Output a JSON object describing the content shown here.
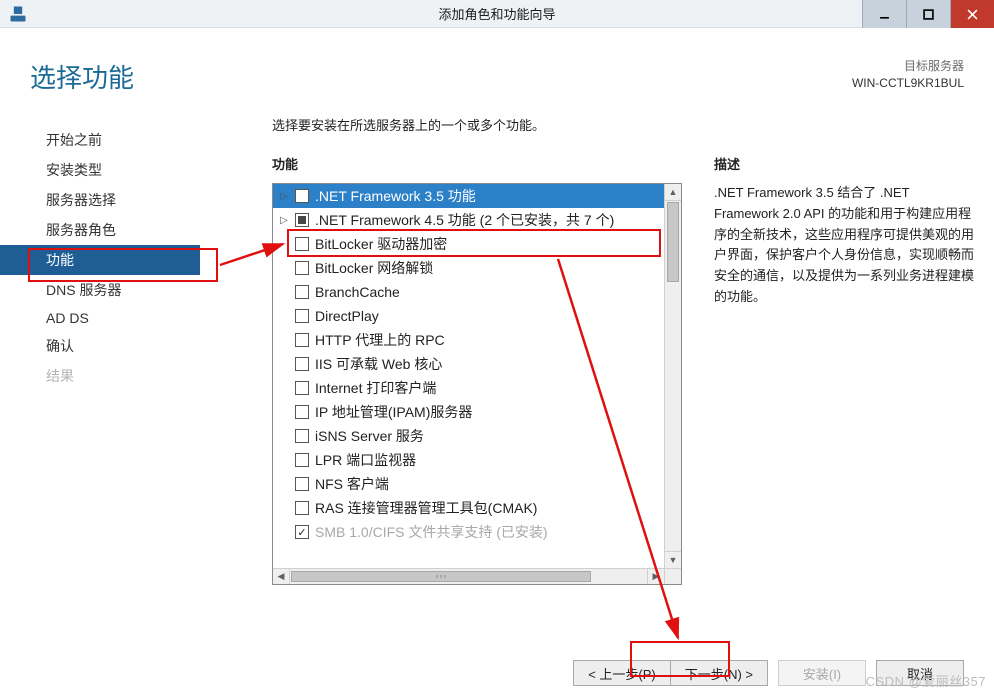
{
  "window": {
    "title": "添加角色和功能向导"
  },
  "header": {
    "title": "选择功能",
    "target_label": "目标服务器",
    "target_name": "WIN-CCTL9KR1BUL"
  },
  "steps": {
    "items": [
      {
        "label": "开始之前",
        "active": false,
        "disabled": false
      },
      {
        "label": "安装类型",
        "active": false,
        "disabled": false
      },
      {
        "label": "服务器选择",
        "active": false,
        "disabled": false
      },
      {
        "label": "服务器角色",
        "active": false,
        "disabled": false
      },
      {
        "label": "功能",
        "active": true,
        "disabled": false
      },
      {
        "label": "DNS 服务器",
        "active": false,
        "disabled": false
      },
      {
        "label": "AD DS",
        "active": false,
        "disabled": false
      },
      {
        "label": "确认",
        "active": false,
        "disabled": false
      },
      {
        "label": "结果",
        "active": false,
        "disabled": true
      }
    ]
  },
  "main": {
    "instruction": "选择要安装在所选服务器上的一个或多个功能。",
    "features_label": "功能",
    "description_label": "描述",
    "description": ".NET Framework 3.5 结合了 .NET Framework 2.0 API 的功能和用于构建应用程序的全新技术，这些应用程序可提供美观的用户界面，保护客户个人身份信息，实现顺畅而安全的通信，以及提供为一系列业务进程建模的功能。",
    "features": [
      {
        "label": ".NET Framework 3.5 功能",
        "checked": "none",
        "expand": "right",
        "selected": true,
        "disabled": false
      },
      {
        "label": ".NET Framework 4.5 功能 (2 个已安装，共 7 个)",
        "checked": "partial",
        "expand": "right",
        "selected": false,
        "disabled": false
      },
      {
        "label": "BitLocker 驱动器加密",
        "checked": "none",
        "expand": "none",
        "selected": false,
        "disabled": false
      },
      {
        "label": "BitLocker 网络解锁",
        "checked": "none",
        "expand": "none",
        "selected": false,
        "disabled": false
      },
      {
        "label": "BranchCache",
        "checked": "none",
        "expand": "none",
        "selected": false,
        "disabled": false
      },
      {
        "label": "DirectPlay",
        "checked": "none",
        "expand": "none",
        "selected": false,
        "disabled": false
      },
      {
        "label": "HTTP 代理上的 RPC",
        "checked": "none",
        "expand": "none",
        "selected": false,
        "disabled": false
      },
      {
        "label": "IIS 可承载 Web 核心",
        "checked": "none",
        "expand": "none",
        "selected": false,
        "disabled": false
      },
      {
        "label": "Internet 打印客户端",
        "checked": "none",
        "expand": "none",
        "selected": false,
        "disabled": false
      },
      {
        "label": "IP 地址管理(IPAM)服务器",
        "checked": "none",
        "expand": "none",
        "selected": false,
        "disabled": false
      },
      {
        "label": "iSNS Server 服务",
        "checked": "none",
        "expand": "none",
        "selected": false,
        "disabled": false
      },
      {
        "label": "LPR 端口监视器",
        "checked": "none",
        "expand": "none",
        "selected": false,
        "disabled": false
      },
      {
        "label": "NFS 客户端",
        "checked": "none",
        "expand": "none",
        "selected": false,
        "disabled": false
      },
      {
        "label": "RAS 连接管理器管理工具包(CMAK)",
        "checked": "none",
        "expand": "none",
        "selected": false,
        "disabled": false
      },
      {
        "label": "SMB 1.0/CIFS 文件共享支持 (已安装)",
        "checked": "checked",
        "expand": "none",
        "selected": false,
        "disabled": true
      }
    ]
  },
  "footer": {
    "back": "< 上一步(P)",
    "next": "下一步(N) >",
    "install": "安装(I)",
    "cancel": "取消"
  },
  "watermark": "CSDN @爱丽丝357"
}
